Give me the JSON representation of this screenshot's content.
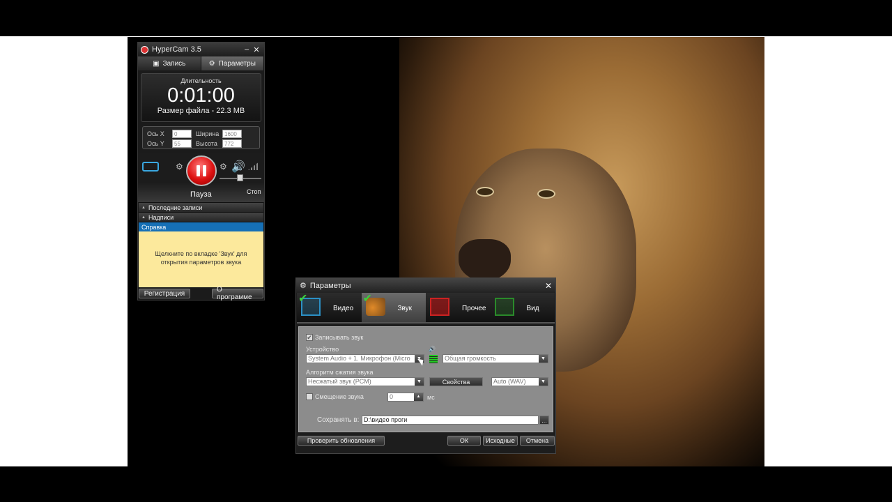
{
  "hypercam": {
    "title": "HyperCam 3.5",
    "minimize": "–",
    "close": "✕",
    "tabs": [
      {
        "label": "Запись",
        "icon": "camera-icon"
      },
      {
        "label": "Параметры",
        "icon": "gear-icon"
      }
    ],
    "timer": {
      "label": "Длительность",
      "value": "0:01:00",
      "file_size": "Размер файла - 22.3 MB"
    },
    "coords": {
      "x_label": "Ось X",
      "x_value": "0",
      "y_label": "Ось Y",
      "y_value": "55",
      "width_label": "Ширина",
      "width_value": "1600",
      "height_label": "Высота",
      "height_value": "772"
    },
    "controls": {
      "pause_label": "Пауза",
      "stop_label": "Стоп"
    },
    "sections": {
      "recent": "Последние записи",
      "captions": "Надписи",
      "help": "Справка"
    },
    "help_text_line1": "Щелкните по вкладке 'Звук' для",
    "help_text_line2": "открытия параметров звука",
    "buttons": {
      "register": "Регистрация",
      "about": "О программе"
    }
  },
  "params_dialog": {
    "title": "Параметры",
    "close": "✕",
    "tabs": [
      {
        "label": "Видео",
        "icon": "video-icon",
        "active": false
      },
      {
        "label": "Звук",
        "icon": "speaker-icon",
        "active": true
      },
      {
        "label": "Прочее",
        "icon": "other-icon",
        "active": false
      },
      {
        "label": "Вид",
        "icon": "view-icon",
        "active": false
      }
    ],
    "record_sound_label": "Записывать звук",
    "record_sound_checked": true,
    "device_label": "Устройство",
    "device_value": "System Audio + 1. Микрофон (Micro",
    "volume_value": "Общая громкость",
    "codec_label": "Алгоритм сжатия звука",
    "codec_value": "Несжатый звук (PCM)",
    "properties_button": "Свойства",
    "format_value": "Auto (WAV)",
    "offset_label": "Смещение звука",
    "offset_checked": false,
    "offset_value": "0",
    "offset_unit": "мс",
    "save_label": "Сохранять в:",
    "save_value": "D:\\видео проги",
    "browse_button": "...",
    "footer": {
      "check_updates": "Проверить обновления",
      "ok": "ОК",
      "defaults": "Исходные",
      "cancel": "Отмена"
    }
  }
}
